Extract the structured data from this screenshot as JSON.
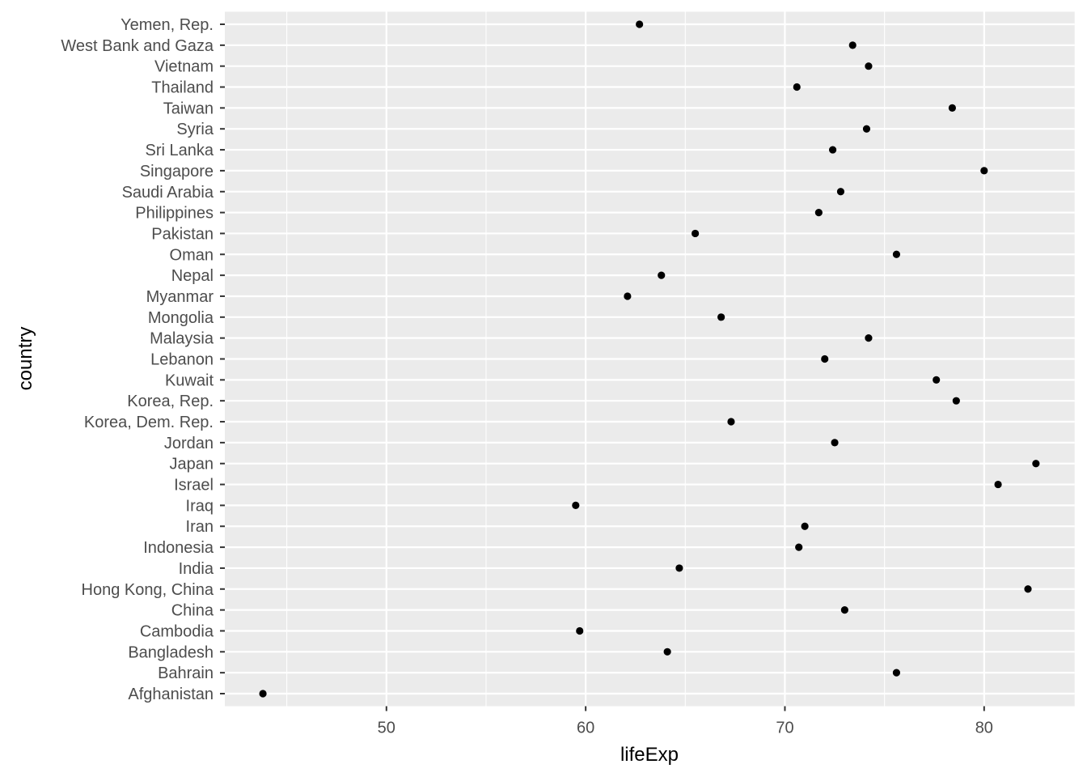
{
  "chart_data": {
    "type": "scatter",
    "title": "",
    "xlabel": "lifeExp",
    "ylabel": "country",
    "xlim": [
      41.889,
      84.542
    ],
    "x_ticks": [
      50,
      60,
      70,
      80
    ],
    "x_tick_labels": [
      "50",
      "60",
      "70",
      "80"
    ],
    "x_minor_ticks": [
      45,
      55,
      65,
      75
    ],
    "grid": true,
    "legend": "none",
    "colors": {
      "panel_background": "#ebebeb",
      "grid_major": "#ffffff",
      "grid_minor": "#ffffff",
      "point": "#000000",
      "tick_text": "#4d4d4d",
      "tick_mark": "#333333",
      "axis_title": "#000000"
    },
    "categories": [
      "Afghanistan",
      "Bahrain",
      "Bangladesh",
      "Cambodia",
      "China",
      "Hong Kong, China",
      "India",
      "Indonesia",
      "Iran",
      "Iraq",
      "Israel",
      "Japan",
      "Jordan",
      "Korea, Dem. Rep.",
      "Korea, Rep.",
      "Kuwait",
      "Lebanon",
      "Malaysia",
      "Mongolia",
      "Myanmar",
      "Nepal",
      "Oman",
      "Pakistan",
      "Philippines",
      "Saudi Arabia",
      "Singapore",
      "Sri Lanka",
      "Syria",
      "Taiwan",
      "Thailand",
      "Vietnam",
      "West Bank and Gaza",
      "Yemen, Rep."
    ],
    "values": [
      43.8,
      75.6,
      64.1,
      59.7,
      73.0,
      82.2,
      64.7,
      70.7,
      71.0,
      59.5,
      80.7,
      82.6,
      72.5,
      67.3,
      78.6,
      77.6,
      72.0,
      74.2,
      66.8,
      62.1,
      63.8,
      75.6,
      65.5,
      71.7,
      72.8,
      80.0,
      72.4,
      74.1,
      78.4,
      70.6,
      74.2,
      73.4,
      62.7
    ]
  }
}
